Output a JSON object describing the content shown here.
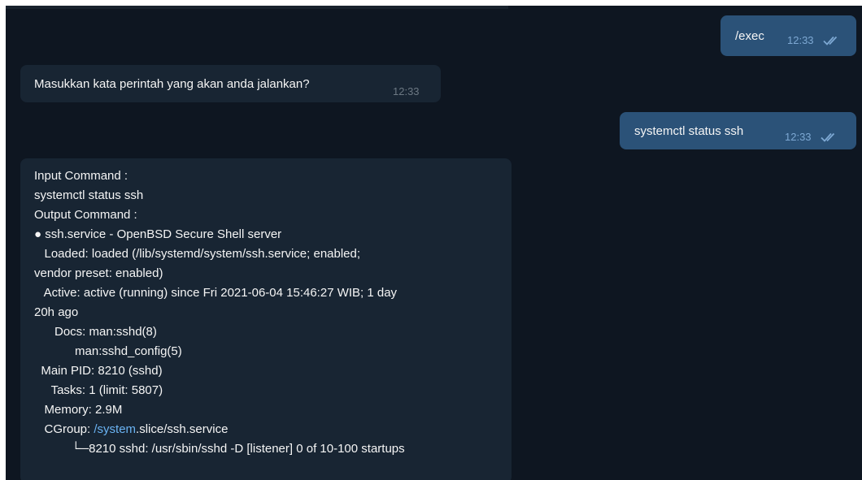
{
  "messages": [
    {
      "text": "/exec",
      "time": "12:33"
    },
    {
      "text": "Masukkan kata perintah yang akan anda jalankan?",
      "time": "12:33"
    },
    {
      "text": "systemctl status ssh",
      "time": "12:33"
    }
  ],
  "output": {
    "line1": "Input Command :",
    "line2": "systemctl status ssh",
    "line3": "Output Command :",
    "line4": "● ssh.service - OpenBSD Secure Shell server",
    "line5": "   Loaded: loaded (/lib/systemd/system/ssh.service; enabled;",
    "line6": "vendor preset: enabled)",
    "line7": "   Active: active (running) since Fri 2021-06-04 15:46:27 WIB; 1 day",
    "line8": "20h ago",
    "line9": "      Docs: man:sshd(8)",
    "line10": "            man:sshd_config(5)",
    "line11": "  Main PID: 8210 (sshd)",
    "line12": "     Tasks: 1 (limit: 5807)",
    "line13": "   Memory: 2.9M",
    "line14_prefix": "   CGroup: ",
    "line14_link": "/system",
    "line14_suffix": ".slice/ssh.service",
    "line15": "           └─8210 sshd: /usr/sbin/sshd -D [listener] 0 of 10-100 startups"
  },
  "icons": {
    "read": "double-check-icon"
  },
  "colors": {
    "background": "#0e1621",
    "outgoing": "#2b5278",
    "incoming": "#182533",
    "link": "#6ab3f3"
  }
}
